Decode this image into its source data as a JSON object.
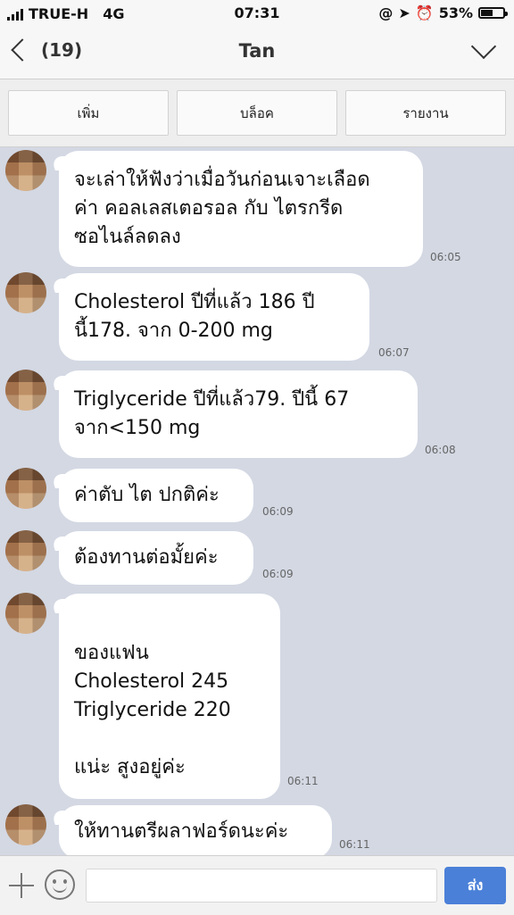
{
  "status_bar": {
    "carrier": "TRUE-H",
    "network": "4G",
    "time": "07:31",
    "battery": "53%",
    "battery_level": 0.53,
    "icons": [
      "signal-icon",
      "at-icon",
      "location-icon",
      "alarm-icon",
      "battery-icon"
    ]
  },
  "header": {
    "back_count": "(19)",
    "title": "Tan",
    "menu_icon": "chevron-down-icon"
  },
  "actions": {
    "add": "เพิ่ม",
    "block": "บล็อค",
    "report": "รายงาน"
  },
  "messages": [
    {
      "lines": [
        "จะเล่าให้ฟังว่าเมื่อวันก่อนเจาะเลือด",
        "ค่า คอลเลสเตอรอล กับ ไตรกรีด",
        "ซอไนล์ลดลง"
      ],
      "time": "06:05"
    },
    {
      "lines": [
        "Cholesterol ปีที่แล้ว 186 ปี",
        "นี้178. จาก 0-200 mg"
      ],
      "time": "06:07"
    },
    {
      "lines": [
        "Triglyceride  ปีที่แล้ว79. ปีนี้ 67",
        "จาก<150 mg"
      ],
      "time": "06:08"
    },
    {
      "lines": [
        "ค่าตับ ไต ปกติค่ะ"
      ],
      "time": "06:09"
    },
    {
      "lines": [
        "ต้องทานต่อมั้ยค่ะ"
      ],
      "time": "06:09"
    },
    {
      "lines": [
        "",
        "ของแฟน",
        "Cholesterol 245",
        "Triglyceride 220",
        "",
        "แน่ะ สูงอยู่ค่ะ"
      ],
      "time": "06:11"
    },
    {
      "lines": [
        "ให้ทานตรีผลาฟอร์ดนะค่ะ"
      ],
      "time": "06:11"
    }
  ],
  "input": {
    "placeholder": "",
    "value": "",
    "send_label": "ส่ง"
  },
  "colors": {
    "chat_background": "#d3d8e3",
    "bubble": "#ffffff",
    "send_button": "#4a80d8"
  }
}
